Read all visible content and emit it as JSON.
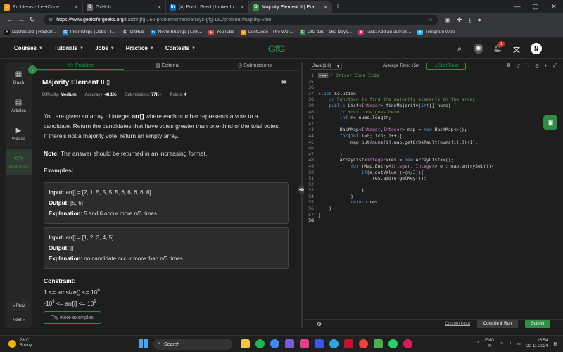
{
  "browser": {
    "tabs": [
      {
        "title": "Problems - LeetCode",
        "fav": "L",
        "color": "#ffa116"
      },
      {
        "title": "GitHub",
        "fav": "G",
        "color": "#6e6e6e"
      },
      {
        "title": "(4) Post | Feed | LinkedIn",
        "fav": "in",
        "color": "#0a66c2"
      },
      {
        "title": "Majority Element II | Practice | Ge",
        "fav": "G",
        "color": "#2f8d46"
      }
    ],
    "url_host": "https://www.geeksforgeeks.org",
    "url_path": "/batch/gfg-160-problems/track/arrays-gfg-160/problem/majority-vote",
    "bookmarks": [
      {
        "label": "Dashboard | Hacker...",
        "fav": "H",
        "color": "#111"
      },
      {
        "label": "Internships | Jobs | T...",
        "fav": "IS",
        "color": "#1e88e5"
      },
      {
        "label": "GitHub",
        "fav": "G",
        "color": "#444"
      },
      {
        "label": "Nikhil Bhange | Link...",
        "fav": "in",
        "color": "#0a66c2"
      },
      {
        "label": "YouTube",
        "fav": "▶",
        "color": "#e53935"
      },
      {
        "label": "LeetCode - The Wor...",
        "fav": "L",
        "color": "#ffa116"
      },
      {
        "label": "GfG 160 - 160 Days...",
        "fav": "G",
        "color": "#2f8d46"
      },
      {
        "label": "Task: Add an authori...",
        "fav": "✿",
        "color": "#e91e63"
      },
      {
        "label": "Telegram Web",
        "fav": "➤",
        "color": "#29b6f6"
      }
    ]
  },
  "nav": {
    "items": [
      "Courses",
      "Tutorials",
      "Jobs",
      "Practice",
      "Contests"
    ],
    "logo": "GfG",
    "notif_count": "1",
    "avatar": "N"
  },
  "sidebar": {
    "items": [
      {
        "label": "Dash",
        "icon": "▦"
      },
      {
        "label": "Articles",
        "icon": "▤"
      },
      {
        "label": "Videos",
        "icon": "▶"
      },
      {
        "label": "Problems",
        "icon": "</>"
      }
    ],
    "prev": "« Prev",
    "next": "Next »"
  },
  "problem": {
    "tabs": [
      "</> Problem",
      "▤ Editorial",
      "◷ Submissions"
    ],
    "title": "Majority Element II",
    "difficulty_label": "Difficulty:",
    "difficulty": "Medium",
    "accuracy_label": "Accuracy:",
    "accuracy": "48.1%",
    "submissions_label": "Submissions:",
    "submissions": "77K+",
    "points_label": "Points:",
    "points": "4",
    "desc_1": "You are given an array of integer",
    "desc_arr": "arr[]",
    "desc_2": "where each number represents a vote to a candidate. Return the candidates that have votes greater than one-third of the total votes, If there's not a majority vote, return an empty array.",
    "note_label": "Note:",
    "note": "The answer should be returned in an increasing format.",
    "examples_label": "Examples:",
    "examples": [
      {
        "input": "arr[] = [2, 1, 5, 5, 5, 5, 6, 6, 6, 6, 6]",
        "output": "[5, 6]",
        "explanation": "5 and 6 occur more n/3 times."
      },
      {
        "input": "arr[] = [1, 2, 3, 4, 5]",
        "output": "[]",
        "explanation": "no candidate occur more than n/3 times."
      }
    ],
    "input_label": "Input:",
    "output_label": "Output:",
    "explanation_label": "Explanation:",
    "constraint_label": "Constraint:",
    "c1_left": "1 <= arr.size() <= 10",
    "c1_exp": "6",
    "c2_left": "-10",
    "c2_exp1": "9",
    "c2_mid": " <= arr[i] <= 10",
    "c2_exp2": "9",
    "try_more": "Try more examples"
  },
  "editor": {
    "language": "Java (1.8)",
    "average_time": "Average Time: 15m",
    "start_timer": "Start Timer",
    "custom_input": "Custom Input",
    "compile_run": "Compile & Run",
    "submit": "Submit"
  },
  "taskbar": {
    "temp": "28°C",
    "weather": "Sunny",
    "search_placeholder": "Search",
    "lang": "ENG",
    "region": "IN",
    "time": "15:54",
    "date": "20-11-2024"
  }
}
